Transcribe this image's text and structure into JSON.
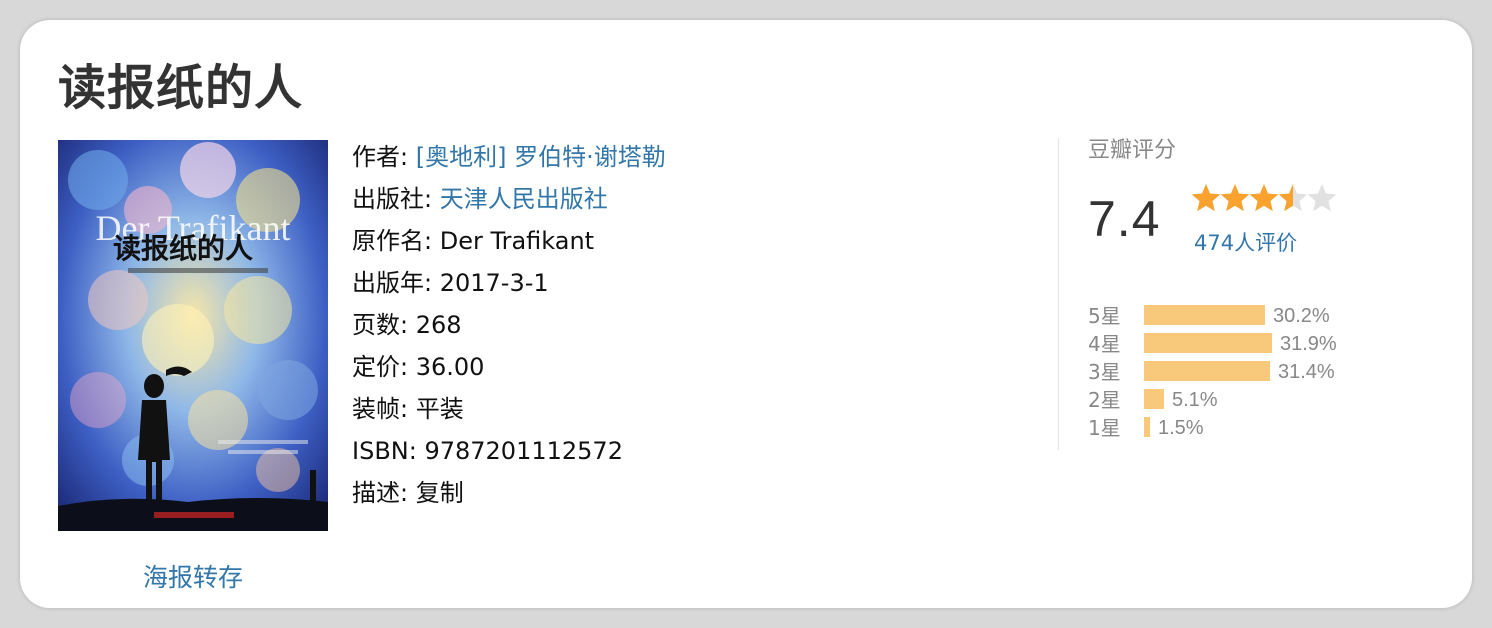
{
  "book": {
    "title": "读报纸的人",
    "poster_link": "海报转存",
    "cover_text": {
      "english": "Der Trafikant",
      "chinese": "读报纸的人"
    }
  },
  "info": {
    "author_label": "作者: ",
    "author_value": "[奥地利] 罗伯特·谢塔勒",
    "publisher_label": "出版社: ",
    "publisher_value": "天津人民出版社",
    "original_title_label": "原作名: ",
    "original_title_value": "Der Trafikant",
    "year_label": "出版年: ",
    "year_value": "2017-3-1",
    "pages_label": "页数: ",
    "pages_value": "268",
    "price_label": "定价: ",
    "price_value": "36.00",
    "binding_label": "装帧: ",
    "binding_value": "平装",
    "isbn_label": "ISBN: ",
    "isbn_value": "9787201112572",
    "desc_label": "描述: ",
    "desc_value": "复制"
  },
  "rating": {
    "label": "豆瓣评分",
    "score": "7.4",
    "stars_out_of_5": 3.5,
    "raters": "474人评价",
    "distribution": [
      {
        "label": "5星",
        "percent": 30.2,
        "text": "30.2%"
      },
      {
        "label": "4星",
        "percent": 31.9,
        "text": "31.9%"
      },
      {
        "label": "3星",
        "percent": 31.4,
        "text": "31.4%"
      },
      {
        "label": "2星",
        "percent": 5.1,
        "text": "5.1%"
      },
      {
        "label": "1星",
        "percent": 1.5,
        "text": "1.5%"
      }
    ]
  },
  "colors": {
    "link": "#3377aa",
    "star": "#f9a22d",
    "star_empty": "#e1e1e1",
    "bar": "#f8c87b"
  }
}
